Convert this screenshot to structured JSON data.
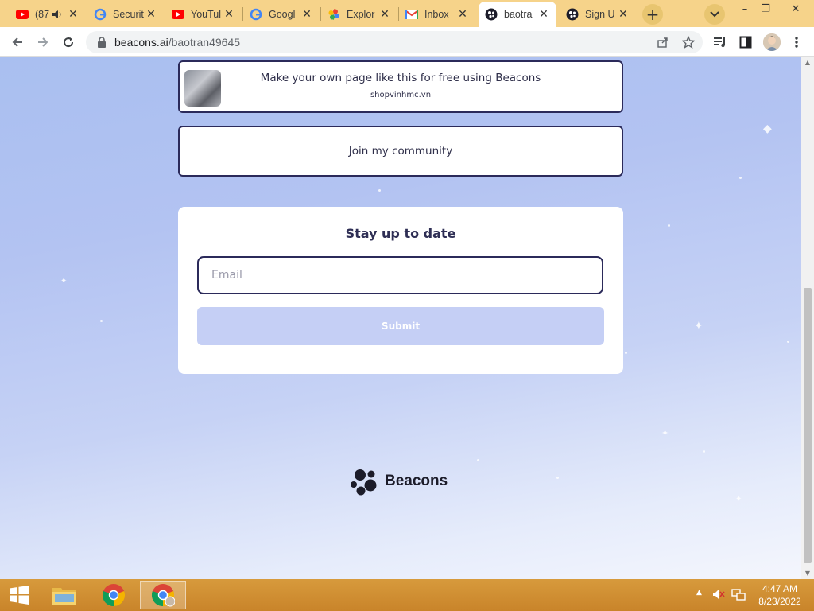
{
  "browser": {
    "tabs": [
      {
        "title": "(87",
        "favicon": "youtube-icon",
        "audio": true
      },
      {
        "title": "Securit",
        "favicon": "google-icon"
      },
      {
        "title": "YouTul",
        "favicon": "youtube-icon"
      },
      {
        "title": "Googl",
        "favicon": "google-icon"
      },
      {
        "title": "Explor",
        "favicon": "google-photos-icon"
      },
      {
        "title": "Inbox",
        "favicon": "gmail-icon"
      },
      {
        "title": "baotra",
        "favicon": "beacons-icon",
        "active": true
      },
      {
        "title": "Sign U",
        "favicon": "beacons-icon"
      }
    ],
    "close_glyph": "✕",
    "new_tab_glyph": "+",
    "url": {
      "domain": "beacons.ai",
      "path": "/baotran49645"
    },
    "window_controls": {
      "minimize": "–",
      "restore": "❐",
      "close": "✕"
    }
  },
  "page": {
    "promo_card": {
      "title": "Make your own page like this for free using Beacons",
      "subtitle": "shopvinhmc.vn"
    },
    "community_link": {
      "label": "Join my community"
    },
    "subscribe": {
      "title": "Stay up to date",
      "email_placeholder": "Email",
      "submit_label": "Submit"
    },
    "footer_brand": "Beacons"
  },
  "taskbar": {
    "time": "4:47 AM",
    "date": "8/23/2022"
  },
  "colors": {
    "accent_border": "#2b2a5a",
    "submit_bg": "#c5cff5",
    "tab_strip": "#f6d38a",
    "taskbar": "#d79a3c"
  }
}
